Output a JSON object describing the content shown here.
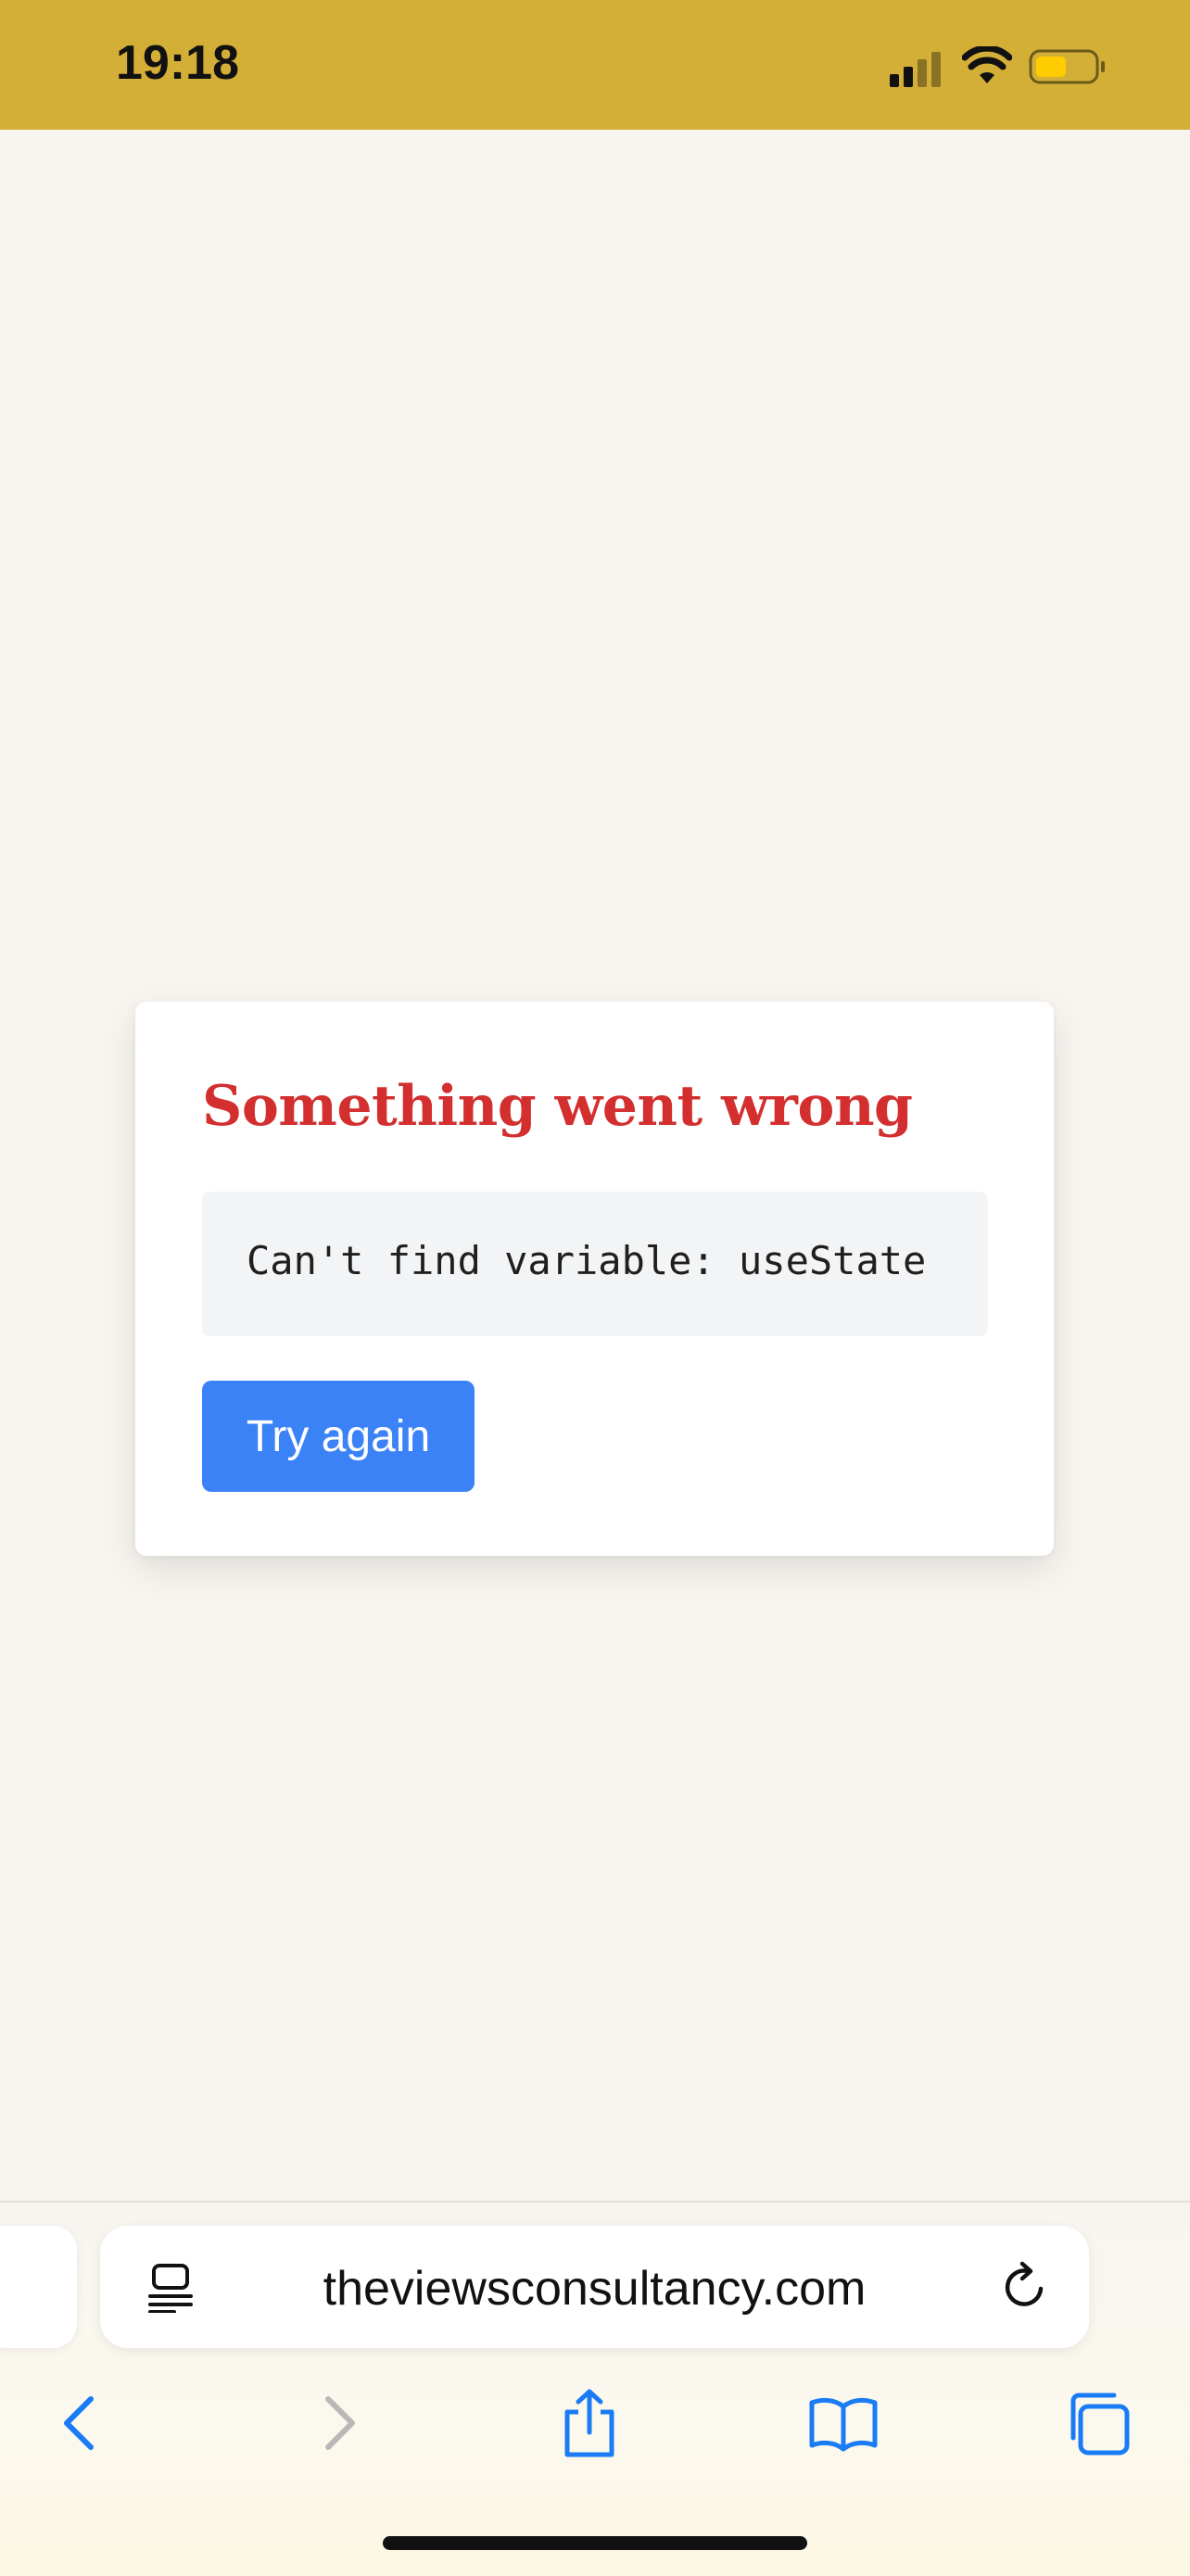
{
  "status_bar": {
    "time": "19:18",
    "background": "#d4af37",
    "icons": [
      "cellular-signal-icon",
      "wifi-icon",
      "battery-icon"
    ],
    "battery_fill_fraction": 0.5,
    "battery_color": "#ffcc00"
  },
  "error_card": {
    "title": "Something went wrong",
    "title_color": "#d32f2f",
    "message": "Can't find variable: useState",
    "button_label": "Try again",
    "button_color": "#3b82f6"
  },
  "browser": {
    "url": "theviewsconsultancy.com",
    "address_bar_icons": [
      "reader-mode-icon",
      "reload-icon"
    ],
    "toolbar_icons": [
      "back-icon",
      "forward-icon",
      "share-icon",
      "bookmarks-icon",
      "tabs-icon"
    ],
    "accent_color": "#1a7cf5",
    "disabled_color": "#b8b8b8"
  }
}
